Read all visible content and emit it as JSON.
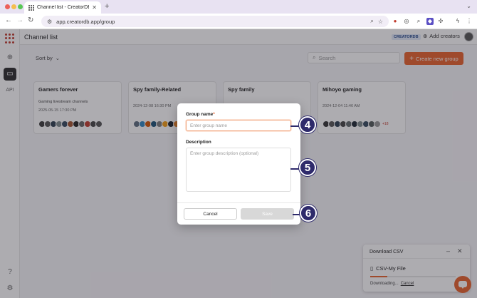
{
  "browser": {
    "tab_title": "Channel list - CreatorDB",
    "url": "app.creatordb.app/group",
    "new_tab": "+"
  },
  "app": {
    "page_title": "Channel list",
    "brand_badge": "CREATORDB",
    "add_creators_label": "Add creators",
    "sidebar": {
      "api_label": "API"
    },
    "toolbar": {
      "sort_label": "Sort by",
      "search_placeholder": "Search",
      "create_label": "Create new group"
    },
    "cards": [
      {
        "title": "Gamers forever",
        "description": "Gaming livestream channels",
        "date": "2025-05-15 17:30 PM",
        "avatars": [
          "#3a3a3a",
          "#555",
          "#2c3e50",
          "#7f8c8d",
          "#34495e",
          "#a0522d",
          "#222",
          "#666",
          "#c0392b",
          "#444",
          "#555"
        ],
        "extra": ""
      },
      {
        "title": "Spy family-Related",
        "description": "",
        "date": "2024-12-08 16:30 PM",
        "avatars": [
          "#5d6d7e",
          "#2e86c1",
          "#d35400",
          "#1a5276",
          "#7b7d7d",
          "#f39c12",
          "#17202a",
          "#e67e22"
        ],
        "extra": ""
      },
      {
        "title": "Spy family",
        "description": "",
        "date": "",
        "avatars": [],
        "extra": ""
      },
      {
        "title": "Mihoyo gaming",
        "description": "",
        "date": "2024-12-04 11:46 AM",
        "avatars": [
          "#333",
          "#555",
          "#2c3e50",
          "#444",
          "#616a6b",
          "#1c2833",
          "#7f8c8d",
          "#34495e",
          "#515a5a",
          "#999"
        ],
        "extra": "+18"
      }
    ]
  },
  "modal": {
    "group_name_label": "Group name",
    "required_mark": "*",
    "group_name_placeholder": "Enter group name",
    "description_label": "Description",
    "description_placeholder": "Enter group description (optional)",
    "cancel_label": "Cancel",
    "save_label": "Save"
  },
  "download_panel": {
    "title": "Download CSV",
    "file_name": "CSV-My File",
    "status": "Downloading...",
    "cancel_label": "Cancel",
    "progress": 0.2
  },
  "steps": [
    "4",
    "5",
    "6"
  ],
  "colors": {
    "accent": "#e8622b",
    "step": "#2e2a6b",
    "sidebar_active": "#2b2b2b"
  }
}
